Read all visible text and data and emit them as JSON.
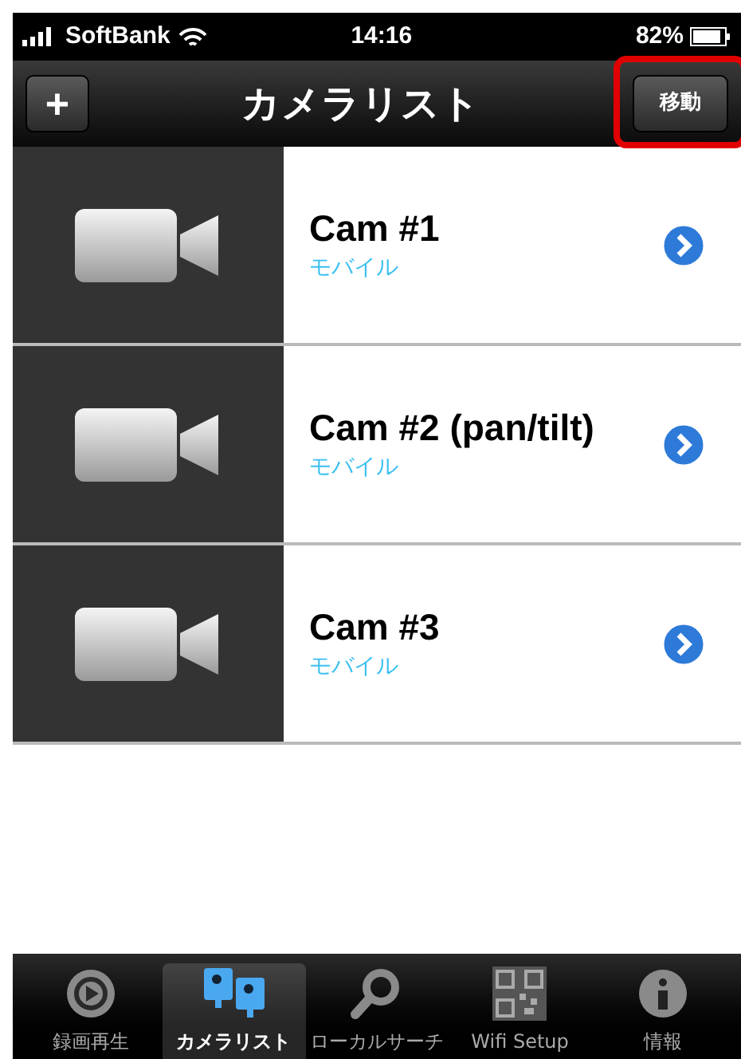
{
  "status_bar": {
    "carrier": "SoftBank",
    "time": "14:16",
    "battery": "82%"
  },
  "nav_bar": {
    "title": "カメラリスト",
    "add_button": "+",
    "move_button": {
      "label": "移動",
      "highlighted": true
    }
  },
  "cameras": [
    {
      "name": "Cam #1",
      "type": "モバイル"
    },
    {
      "name": "Cam #2 (pan/tilt)",
      "type": "モバイル"
    },
    {
      "name": "Cam #3",
      "type": "モバイル"
    }
  ],
  "tab_bar": [
    {
      "label": "録画再生",
      "kind": "playback",
      "selected": false
    },
    {
      "label": "カメラリスト",
      "kind": "cameras",
      "selected": true
    },
    {
      "label": "ローカルサーチ",
      "kind": "search",
      "selected": false
    },
    {
      "label": "Wifi Setup",
      "kind": "qr",
      "selected": false
    },
    {
      "label": "情報",
      "kind": "info",
      "selected": false
    }
  ]
}
